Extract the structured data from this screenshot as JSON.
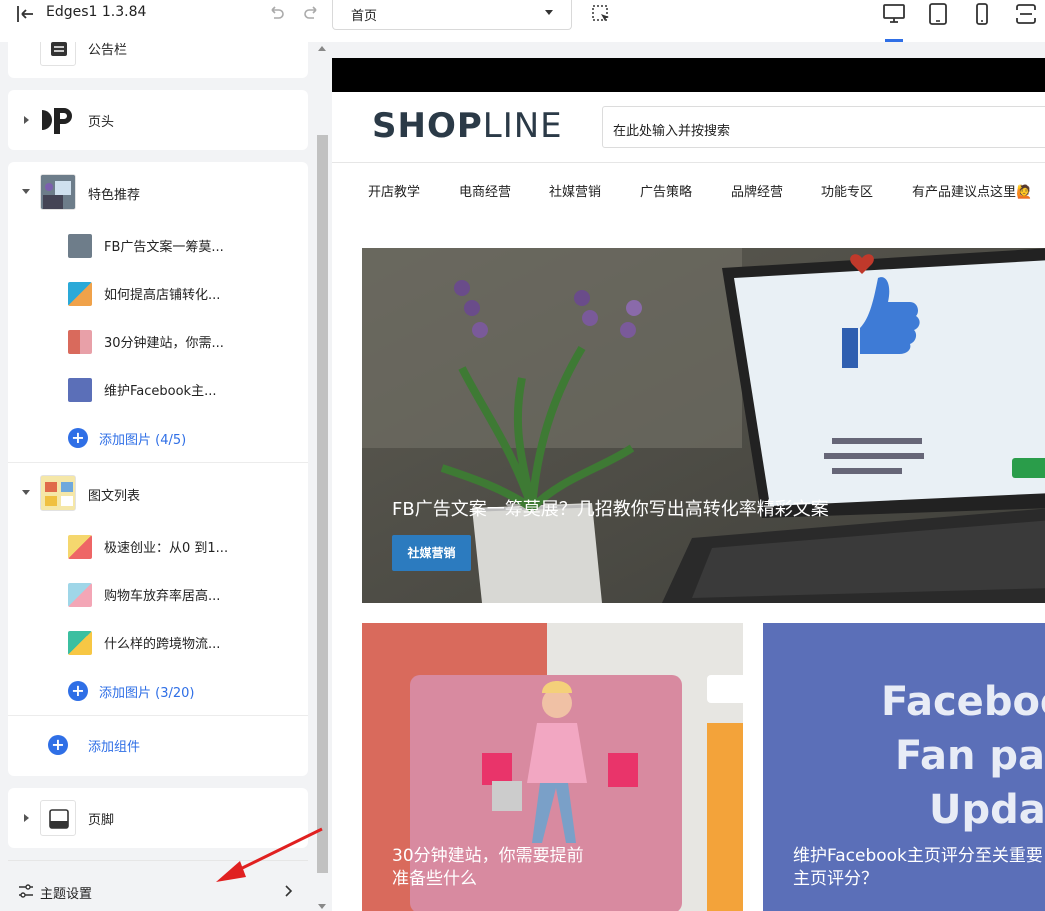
{
  "app": {
    "title": "Edges1 1.3.84"
  },
  "toolbar": {
    "page_select_value": "首页",
    "devices": [
      "desktop-icon",
      "tablet-icon",
      "mobile-icon",
      "fullscreen-icon"
    ],
    "active_device": "desktop",
    "accent": "#2f6fe6"
  },
  "sidebar": {
    "announcement": {
      "label": "公告栏"
    },
    "header": {
      "label": "页头"
    },
    "featured": {
      "label": "特色推荐",
      "items": [
        {
          "label": "FB广告文案一筹莫..."
        },
        {
          "label": "如何提高店铺转化..."
        },
        {
          "label": "30分钟建站，你需..."
        },
        {
          "label": "维护Facebook主..."
        }
      ],
      "add_label": "添加图片 (4/5)"
    },
    "image_list": {
      "label": "图文列表",
      "items": [
        {
          "label": "极速创业：从0 到1..."
        },
        {
          "label": "购物车放弃率居高..."
        },
        {
          "label": "什么样的跨境物流..."
        }
      ],
      "add_label": "添加图片 (3/20)"
    },
    "add_component_label": "添加组件",
    "footer": {
      "label": "页脚"
    },
    "theme_settings_label": "主题设置"
  },
  "preview": {
    "logo_bold": "SHOP",
    "logo_light": "LINE",
    "search_placeholder": "在此处输入并按搜索",
    "nav": [
      "开店教学",
      "电商经营",
      "社媒营销",
      "广告策略",
      "品牌经营",
      "功能专区",
      "有产品建议点这里🙋"
    ],
    "hero": {
      "title": "FB广告文案一筹莫展？几招教你写出高转化率精彩文案",
      "tag": "社媒营销"
    },
    "card2": {
      "title_line1": "30分钟建站，你需要提前",
      "title_line2": "准备些什么"
    },
    "card3": {
      "title_line1": "维护Facebook主页评分至关重要",
      "title_line2": "主页评分？",
      "image_text_1": "Facebook",
      "image_text_2": "Fan page",
      "image_text_3": "Update"
    }
  }
}
